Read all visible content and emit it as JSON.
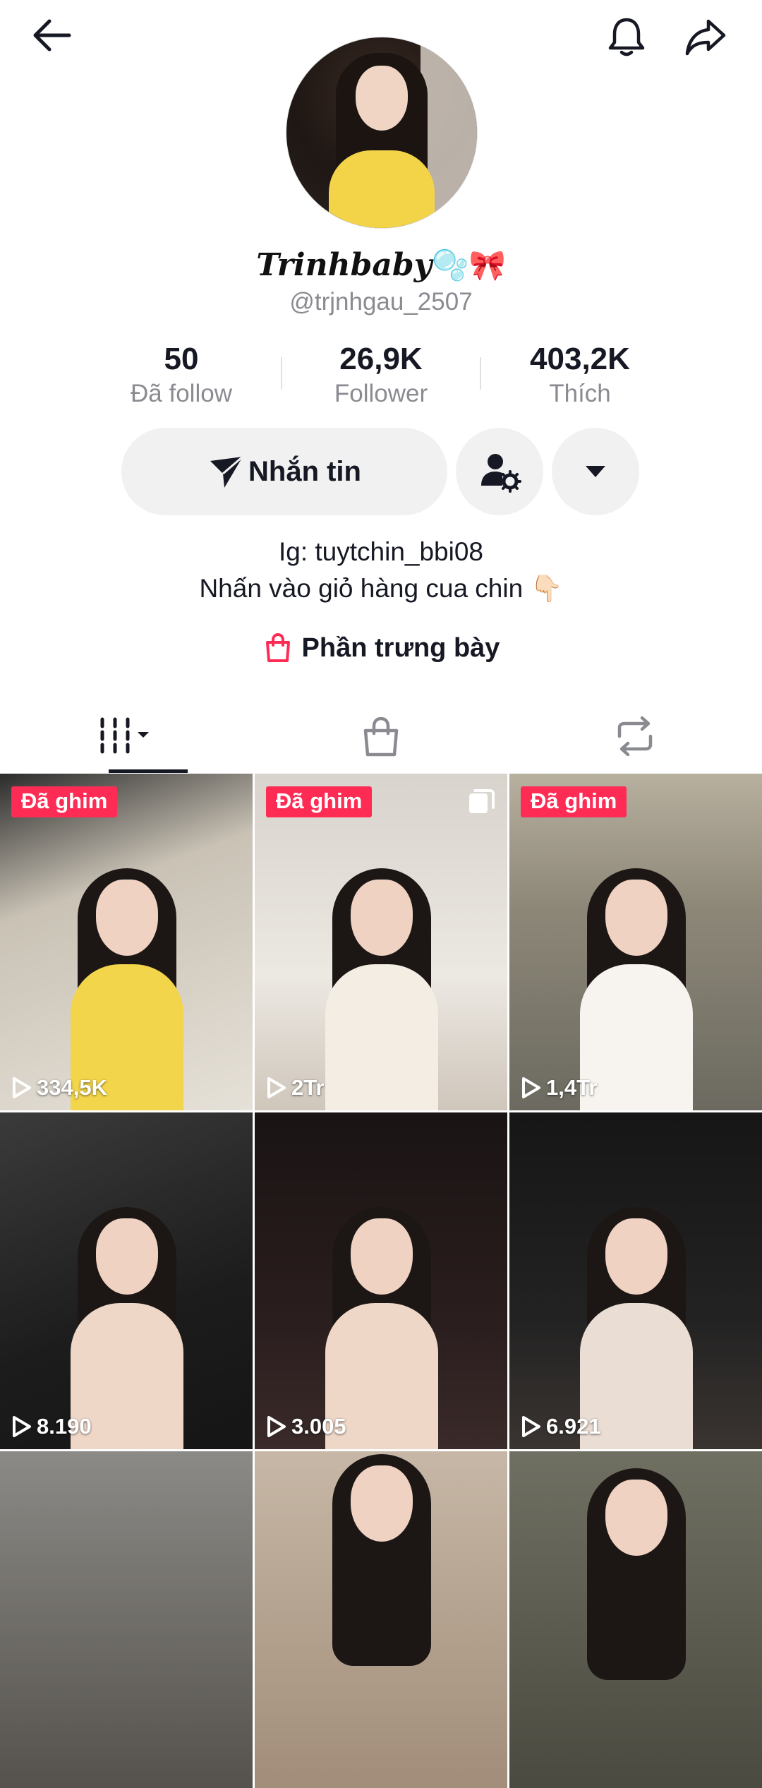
{
  "header": {
    "back_icon": "arrow-left-icon",
    "bell_icon": "bell-icon",
    "share_icon": "share-arrow-icon"
  },
  "profile": {
    "display_name": "Trinhbaby",
    "name_decoration": "🫧🎀",
    "username": "@trjnhgau_2507",
    "stats": [
      {
        "value": "50",
        "label": "Đã follow"
      },
      {
        "value": "26,9K",
        "label": "Follower"
      },
      {
        "value": "403,2K",
        "label": "Thích"
      }
    ],
    "message_button": "Nhắn tin",
    "bio_line1": "Ig: tuytchin_bbi08",
    "bio_line2": "Nhấn vào giỏ hàng cua chin 👇🏻",
    "showcase_label": "Phần trưng bày"
  },
  "tabs": [
    {
      "icon": "videos-grid-icon",
      "active": true
    },
    {
      "icon": "shopping-bag-icon",
      "active": false
    },
    {
      "icon": "repost-icon",
      "active": false
    }
  ],
  "videos": [
    {
      "pinned_label": "Đã ghim",
      "views": "334,5K",
      "multi": false
    },
    {
      "pinned_label": "Đã ghim",
      "views": "2Tr",
      "multi": true
    },
    {
      "pinned_label": "Đã ghim",
      "views": "1,4Tr",
      "multi": false
    },
    {
      "pinned_label": "",
      "views": "8.190",
      "multi": false
    },
    {
      "pinned_label": "",
      "views": "3.005",
      "multi": false
    },
    {
      "pinned_label": "",
      "views": "6.921",
      "multi": false
    },
    {
      "pinned_label": "",
      "views": "",
      "multi": false
    },
    {
      "pinned_label": "",
      "views": "",
      "multi": false
    },
    {
      "pinned_label": "",
      "views": "",
      "multi": false
    }
  ],
  "colors": {
    "accent_pink": "#fe2c55",
    "button_bg": "#f1f1f2",
    "muted_text": "#8a8b91"
  }
}
